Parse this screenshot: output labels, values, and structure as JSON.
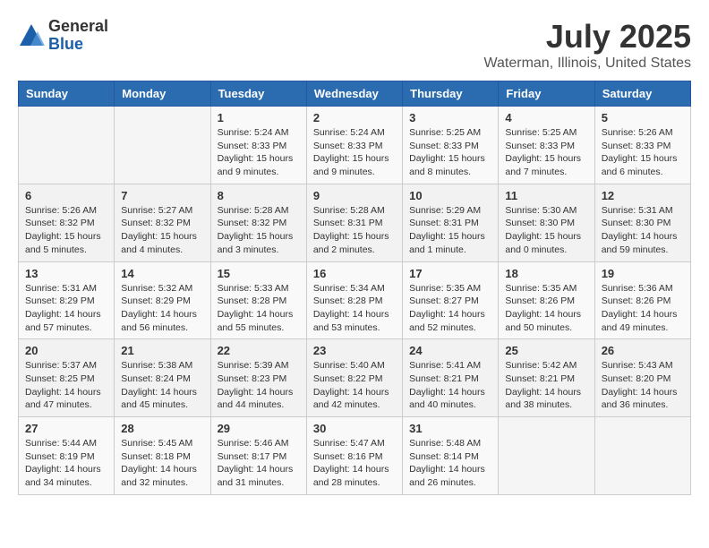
{
  "header": {
    "logo_general": "General",
    "logo_blue": "Blue",
    "title": "July 2025",
    "subtitle": "Waterman, Illinois, United States"
  },
  "calendar": {
    "days_of_week": [
      "Sunday",
      "Monday",
      "Tuesday",
      "Wednesday",
      "Thursday",
      "Friday",
      "Saturday"
    ],
    "weeks": [
      [
        {
          "day": "",
          "info": ""
        },
        {
          "day": "",
          "info": ""
        },
        {
          "day": "1",
          "info": "Sunrise: 5:24 AM\nSunset: 8:33 PM\nDaylight: 15 hours\nand 9 minutes."
        },
        {
          "day": "2",
          "info": "Sunrise: 5:24 AM\nSunset: 8:33 PM\nDaylight: 15 hours\nand 9 minutes."
        },
        {
          "day": "3",
          "info": "Sunrise: 5:25 AM\nSunset: 8:33 PM\nDaylight: 15 hours\nand 8 minutes."
        },
        {
          "day": "4",
          "info": "Sunrise: 5:25 AM\nSunset: 8:33 PM\nDaylight: 15 hours\nand 7 minutes."
        },
        {
          "day": "5",
          "info": "Sunrise: 5:26 AM\nSunset: 8:33 PM\nDaylight: 15 hours\nand 6 minutes."
        }
      ],
      [
        {
          "day": "6",
          "info": "Sunrise: 5:26 AM\nSunset: 8:32 PM\nDaylight: 15 hours\nand 5 minutes."
        },
        {
          "day": "7",
          "info": "Sunrise: 5:27 AM\nSunset: 8:32 PM\nDaylight: 15 hours\nand 4 minutes."
        },
        {
          "day": "8",
          "info": "Sunrise: 5:28 AM\nSunset: 8:32 PM\nDaylight: 15 hours\nand 3 minutes."
        },
        {
          "day": "9",
          "info": "Sunrise: 5:28 AM\nSunset: 8:31 PM\nDaylight: 15 hours\nand 2 minutes."
        },
        {
          "day": "10",
          "info": "Sunrise: 5:29 AM\nSunset: 8:31 PM\nDaylight: 15 hours\nand 1 minute."
        },
        {
          "day": "11",
          "info": "Sunrise: 5:30 AM\nSunset: 8:30 PM\nDaylight: 15 hours\nand 0 minutes."
        },
        {
          "day": "12",
          "info": "Sunrise: 5:31 AM\nSunset: 8:30 PM\nDaylight: 14 hours\nand 59 minutes."
        }
      ],
      [
        {
          "day": "13",
          "info": "Sunrise: 5:31 AM\nSunset: 8:29 PM\nDaylight: 14 hours\nand 57 minutes."
        },
        {
          "day": "14",
          "info": "Sunrise: 5:32 AM\nSunset: 8:29 PM\nDaylight: 14 hours\nand 56 minutes."
        },
        {
          "day": "15",
          "info": "Sunrise: 5:33 AM\nSunset: 8:28 PM\nDaylight: 14 hours\nand 55 minutes."
        },
        {
          "day": "16",
          "info": "Sunrise: 5:34 AM\nSunset: 8:28 PM\nDaylight: 14 hours\nand 53 minutes."
        },
        {
          "day": "17",
          "info": "Sunrise: 5:35 AM\nSunset: 8:27 PM\nDaylight: 14 hours\nand 52 minutes."
        },
        {
          "day": "18",
          "info": "Sunrise: 5:35 AM\nSunset: 8:26 PM\nDaylight: 14 hours\nand 50 minutes."
        },
        {
          "day": "19",
          "info": "Sunrise: 5:36 AM\nSunset: 8:26 PM\nDaylight: 14 hours\nand 49 minutes."
        }
      ],
      [
        {
          "day": "20",
          "info": "Sunrise: 5:37 AM\nSunset: 8:25 PM\nDaylight: 14 hours\nand 47 minutes."
        },
        {
          "day": "21",
          "info": "Sunrise: 5:38 AM\nSunset: 8:24 PM\nDaylight: 14 hours\nand 45 minutes."
        },
        {
          "day": "22",
          "info": "Sunrise: 5:39 AM\nSunset: 8:23 PM\nDaylight: 14 hours\nand 44 minutes."
        },
        {
          "day": "23",
          "info": "Sunrise: 5:40 AM\nSunset: 8:22 PM\nDaylight: 14 hours\nand 42 minutes."
        },
        {
          "day": "24",
          "info": "Sunrise: 5:41 AM\nSunset: 8:21 PM\nDaylight: 14 hours\nand 40 minutes."
        },
        {
          "day": "25",
          "info": "Sunrise: 5:42 AM\nSunset: 8:21 PM\nDaylight: 14 hours\nand 38 minutes."
        },
        {
          "day": "26",
          "info": "Sunrise: 5:43 AM\nSunset: 8:20 PM\nDaylight: 14 hours\nand 36 minutes."
        }
      ],
      [
        {
          "day": "27",
          "info": "Sunrise: 5:44 AM\nSunset: 8:19 PM\nDaylight: 14 hours\nand 34 minutes."
        },
        {
          "day": "28",
          "info": "Sunrise: 5:45 AM\nSunset: 8:18 PM\nDaylight: 14 hours\nand 32 minutes."
        },
        {
          "day": "29",
          "info": "Sunrise: 5:46 AM\nSunset: 8:17 PM\nDaylight: 14 hours\nand 31 minutes."
        },
        {
          "day": "30",
          "info": "Sunrise: 5:47 AM\nSunset: 8:16 PM\nDaylight: 14 hours\nand 28 minutes."
        },
        {
          "day": "31",
          "info": "Sunrise: 5:48 AM\nSunset: 8:14 PM\nDaylight: 14 hours\nand 26 minutes."
        },
        {
          "day": "",
          "info": ""
        },
        {
          "day": "",
          "info": ""
        }
      ]
    ]
  }
}
